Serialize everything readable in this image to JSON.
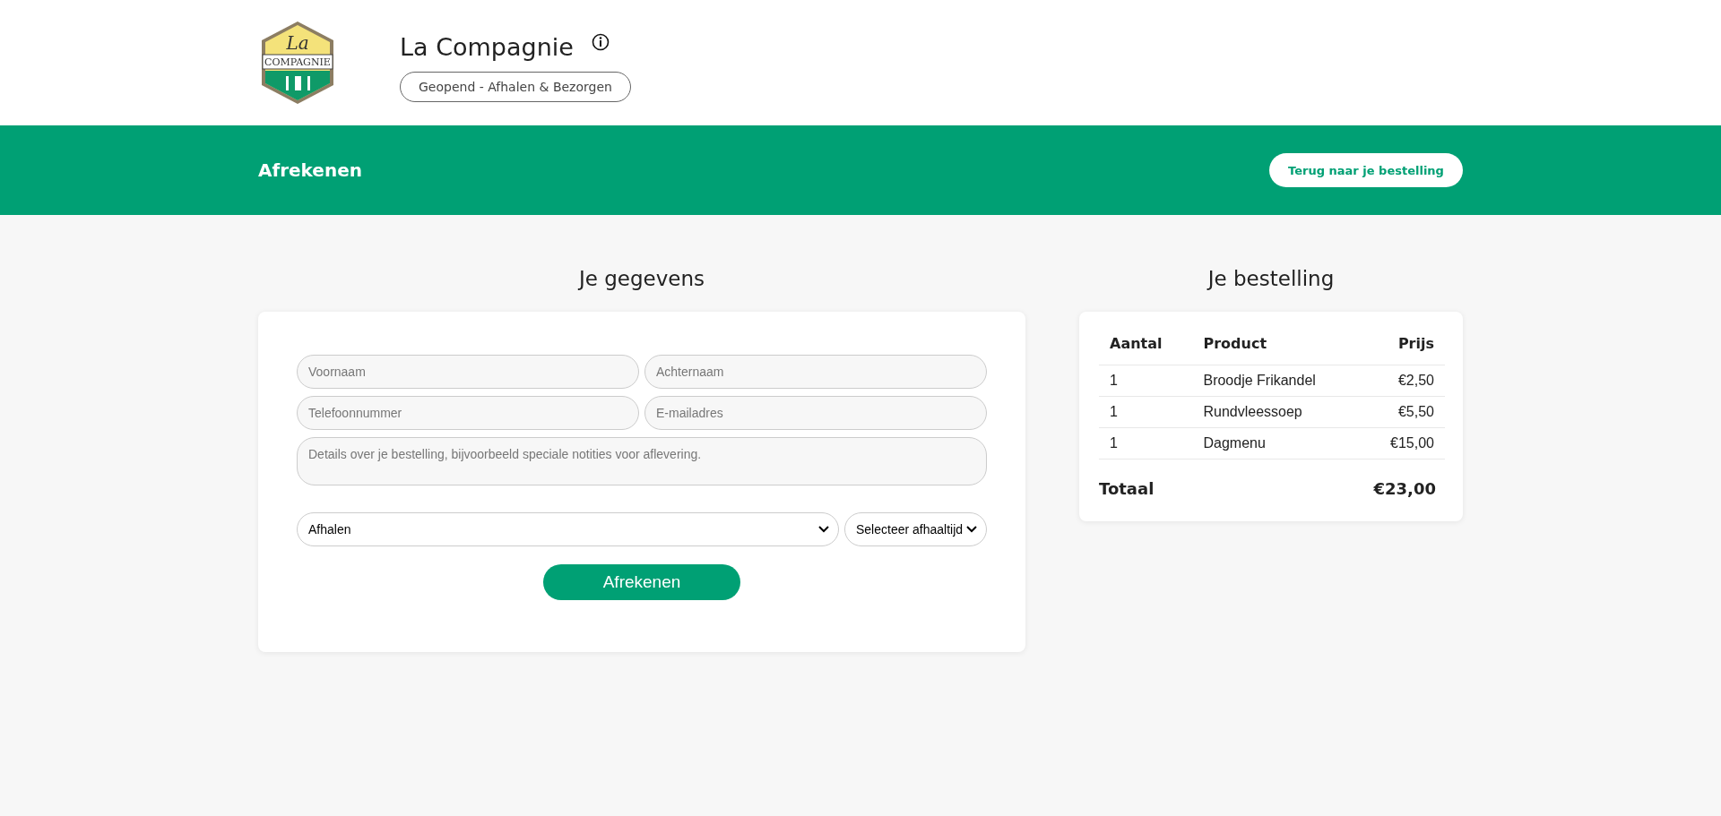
{
  "header": {
    "logo": {
      "script": "La",
      "banner": "COMPAGNIE"
    },
    "title": "La Compagnie",
    "status": "Geopend - Afhalen & Bezorgen"
  },
  "bar": {
    "title": "Afrekenen",
    "back_button": "Terug naar je bestelling"
  },
  "details": {
    "heading": "Je gegevens",
    "fields": [
      {
        "placeholder": "Voornaam"
      },
      {
        "placeholder": "Achternaam"
      },
      {
        "placeholder": "Telefoonnummer"
      },
      {
        "placeholder": "E-mailadres"
      }
    ],
    "notes": {
      "placeholder": "Details over je bestelling, bijvoorbeeld speciale notities voor aflevering."
    },
    "method": {
      "value": "Afhalen"
    },
    "time": {
      "value": "Selecteer afhaaltijd"
    },
    "submit": "Afrekenen"
  },
  "order": {
    "heading": "Je bestelling",
    "columns": [
      "Aantal",
      "Product",
      "Prijs"
    ],
    "rows": [
      {
        "qty": "1",
        "product": "Broodje Frikandel",
        "price": "€2,50"
      },
      {
        "qty": "1",
        "product": "Rundvleessoep",
        "price": "€5,50"
      },
      {
        "qty": "1",
        "product": "Dagmenu",
        "price": "€15,00"
      }
    ],
    "total_label": "Totaal",
    "total": "€23,00"
  }
}
